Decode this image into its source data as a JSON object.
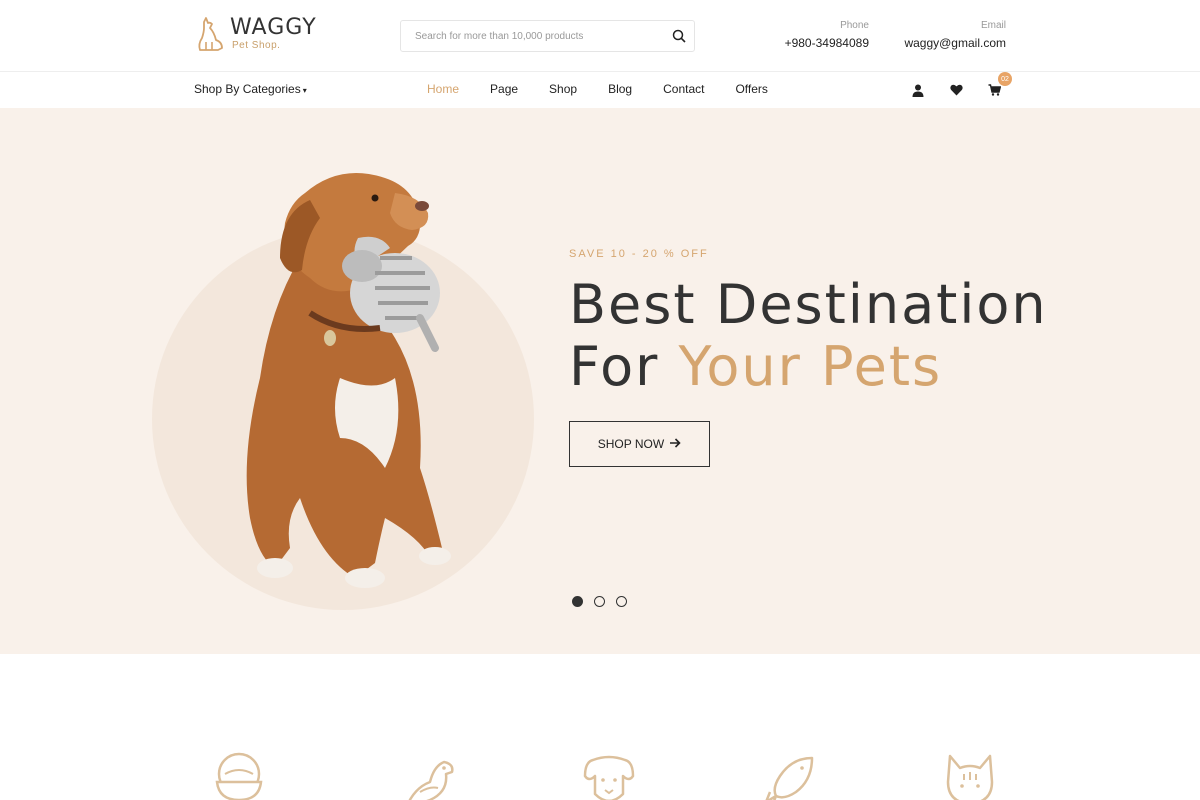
{
  "brand": {
    "name": "WAGGY",
    "tagline": "Pet Shop.",
    "accent": "#d5a56f"
  },
  "search": {
    "placeholder": "Search for more than 10,000 products",
    "icon": "search-icon"
  },
  "contact": {
    "phone_label": "Phone",
    "phone_value": "+980-34984089",
    "email_label": "Email",
    "email_value": "waggy@gmail.com"
  },
  "nav": {
    "categories_label": "Shop By Categories",
    "items": [
      {
        "label": "Home",
        "active": true
      },
      {
        "label": "Page"
      },
      {
        "label": "Shop"
      },
      {
        "label": "Blog"
      },
      {
        "label": "Contact"
      },
      {
        "label": "Offers"
      }
    ],
    "icons": [
      "user-icon",
      "heart-icon",
      "cart-icon"
    ],
    "cart_count": "02"
  },
  "hero": {
    "save_text": "SAVE 10 - 20 % OFF",
    "headline_line1": "Best Destination",
    "headline_line2_plain": "For ",
    "headline_line2_accent": "Your Pets",
    "button_label": "SHOP NOW",
    "background": "#f9f1ea"
  },
  "categories": {
    "icons": [
      "bowl-icon",
      "bird-icon",
      "dog-icon",
      "fish-icon",
      "cat-icon"
    ]
  }
}
